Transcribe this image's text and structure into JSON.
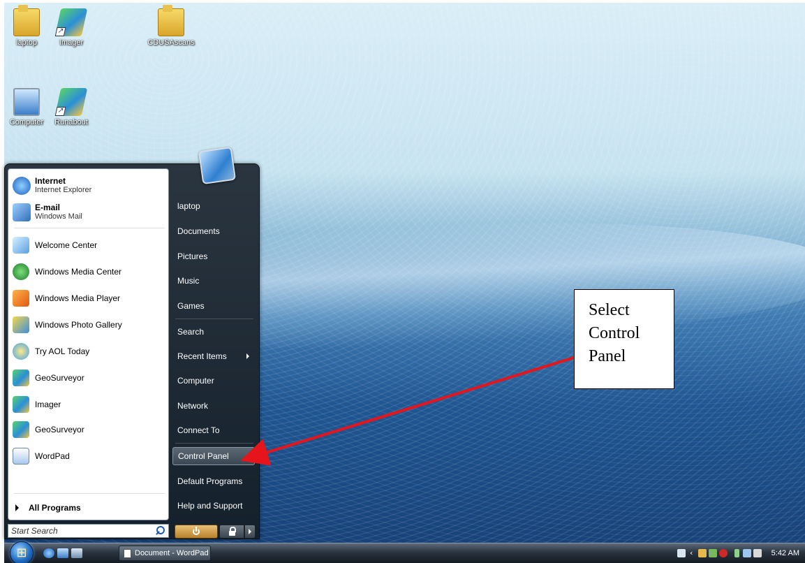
{
  "desktop": {
    "icons": [
      {
        "label": "laptop",
        "icon": "folder-icon"
      },
      {
        "label": "Imager",
        "icon": "imager-app-icon"
      },
      {
        "label": "CDUSAscans",
        "icon": "folder-icon"
      },
      {
        "label": "Computer",
        "icon": "computer-icon"
      },
      {
        "label": "Runabout",
        "icon": "runabout-app-icon"
      }
    ]
  },
  "start_menu": {
    "pinned": [
      {
        "title": "Internet",
        "subtitle": "Internet Explorer",
        "icon": "internet-explorer-icon"
      },
      {
        "title": "E-mail",
        "subtitle": "Windows Mail",
        "icon": "windows-mail-icon"
      }
    ],
    "recent": [
      {
        "label": "Welcome Center",
        "icon": "welcome-center-icon"
      },
      {
        "label": "Windows Media Center",
        "icon": "media-center-icon"
      },
      {
        "label": "Windows Media Player",
        "icon": "media-player-icon"
      },
      {
        "label": "Windows Photo Gallery",
        "icon": "photo-gallery-icon"
      },
      {
        "label": "Try  AOL Today",
        "icon": "aol-icon"
      },
      {
        "label": "GeoSurveyor",
        "icon": "geosurveyor-icon"
      },
      {
        "label": "Imager",
        "icon": "imager-app-icon"
      },
      {
        "label": "GeoSurveyor",
        "icon": "geosurveyor-icon"
      },
      {
        "label": "WordPad",
        "icon": "wordpad-icon"
      }
    ],
    "all_programs": "All Programs",
    "search_placeholder": "Start Search",
    "right": [
      {
        "label": "laptop"
      },
      {
        "label": "Documents"
      },
      {
        "label": "Pictures"
      },
      {
        "label": "Music"
      },
      {
        "label": "Games"
      },
      {
        "label": "Search"
      },
      {
        "label": "Recent Items",
        "has_submenu": true
      },
      {
        "label": "Computer"
      },
      {
        "label": "Network"
      },
      {
        "label": "Connect To"
      },
      {
        "label": "Control Panel",
        "highlighted": true
      },
      {
        "label": "Default Programs"
      },
      {
        "label": "Help and Support"
      }
    ]
  },
  "taskbar": {
    "window_button": "Document - WordPad",
    "clock": "5:42 AM"
  },
  "annotation": {
    "lines": [
      "Select",
      "Control",
      "Panel"
    ],
    "arrow_color": "#e8141b"
  }
}
